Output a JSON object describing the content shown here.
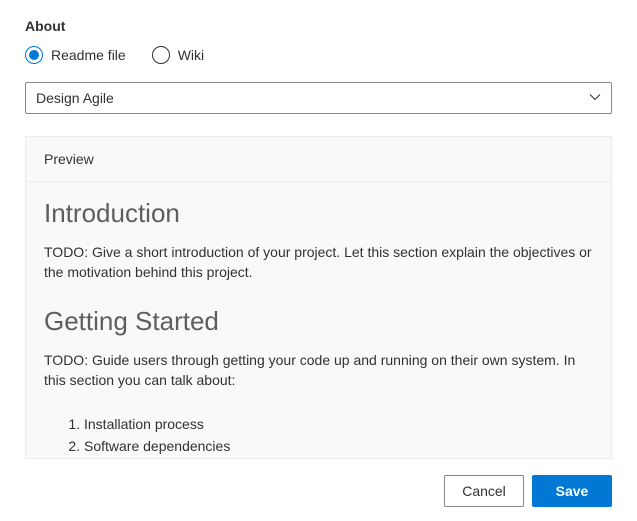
{
  "section_label": "About",
  "radios": {
    "readme": "Readme file",
    "wiki": "Wiki"
  },
  "dropdown": {
    "selected": "Design Agile"
  },
  "preview": {
    "header": "Preview",
    "intro_heading": "Introduction",
    "intro_body": "TODO: Give a short introduction of your project. Let this section explain the objectives or the motivation behind this project.",
    "started_heading": "Getting Started",
    "started_body": "TODO: Guide users through getting your code up and running on their own system. In this section you can talk about:",
    "steps": {
      "s1": "Installation process",
      "s2": "Software dependencies"
    }
  },
  "buttons": {
    "cancel": "Cancel",
    "save": "Save"
  }
}
